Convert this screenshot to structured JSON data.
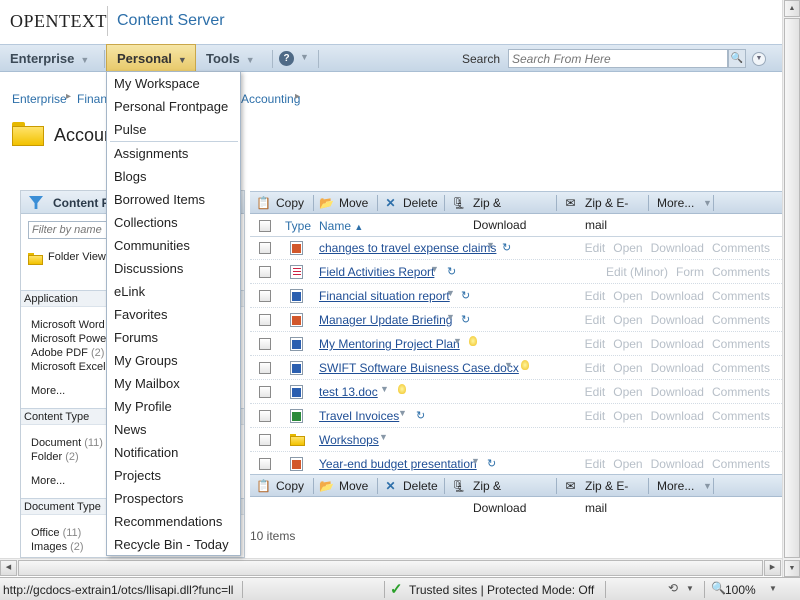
{
  "header": {
    "logo": "OPENTEXT",
    "product": "Content Server"
  },
  "nav": {
    "enterprise": "Enterprise",
    "personal": "Personal",
    "tools": "Tools",
    "search_label": "Search",
    "search_placeholder": "Search From Here"
  },
  "breadcrumb": [
    "Enterprise",
    "Finance",
    "Accounting"
  ],
  "page_title": "Accounting",
  "menu": {
    "items": [
      "My Workspace",
      "Personal Frontpage",
      "Pulse",
      "Assignments",
      "Blogs",
      "Borrowed Items",
      "Collections",
      "Communities",
      "Discussions",
      "eLink",
      "Favorites",
      "Forums",
      "My Groups",
      "My Mailbox",
      "My Profile",
      "News",
      "Notification",
      "Projects",
      "Prospectors",
      "Recommendations",
      "Recycle Bin - Today"
    ]
  },
  "left_panel": {
    "title": "Content Filter",
    "filter_placeholder": "Filter by name",
    "folder_view": "Folder View",
    "application": {
      "header": "Application",
      "items": [
        {
          "label": "Microsoft Word",
          "count": ""
        },
        {
          "label": "Microsoft PowerPoint",
          "count": ""
        },
        {
          "label": "Adobe PDF",
          "count": "(2)"
        },
        {
          "label": "Microsoft Excel",
          "count": ""
        }
      ],
      "more": "More..."
    },
    "content_type": {
      "header": "Content Type",
      "items": [
        {
          "label": "Document",
          "count": "(11)"
        },
        {
          "label": "Folder",
          "count": "(2)"
        }
      ],
      "more": "More..."
    },
    "document_type": {
      "header": "Document Type",
      "items": [
        {
          "label": "Office",
          "count": "(11)"
        },
        {
          "label": "Images",
          "count": "(2)"
        }
      ]
    }
  },
  "toolbar": {
    "copy": "Copy",
    "move": "Move",
    "delete": "Delete",
    "zip_download": "Zip & Download",
    "zip_email": "Zip & E-mail",
    "more": "More..."
  },
  "table": {
    "col_type": "Type",
    "col_name": "Name",
    "rows": [
      {
        "type": "ppt",
        "name": "changes to travel expense claims",
        "actions": [
          "Edit",
          "Open",
          "Download",
          "Comments"
        ]
      },
      {
        "type": "form",
        "name": "Field Activities Report",
        "actions": [
          "Edit (Minor)",
          "Form",
          "Comments"
        ]
      },
      {
        "type": "word",
        "name": "Financial situation report",
        "actions": [
          "Edit",
          "Open",
          "Download",
          "Comments"
        ]
      },
      {
        "type": "ppt",
        "name": "Manager Update Briefing",
        "actions": [
          "Edit",
          "Open",
          "Download",
          "Comments"
        ]
      },
      {
        "type": "word",
        "name": "My Mentoring Project Plan",
        "actions": [
          "Edit",
          "Open",
          "Download",
          "Comments"
        ]
      },
      {
        "type": "word",
        "name": "SWIFT Software Buisness Case.docx",
        "actions": [
          "Edit",
          "Open",
          "Download",
          "Comments"
        ]
      },
      {
        "type": "word",
        "name": "test 13.doc",
        "actions": [
          "Edit",
          "Open",
          "Download",
          "Comments"
        ]
      },
      {
        "type": "xls",
        "name": "Travel Invoices",
        "actions": [
          "Edit",
          "Open",
          "Download",
          "Comments"
        ]
      },
      {
        "type": "folder",
        "name": "Workshops",
        "actions": []
      },
      {
        "type": "ppt",
        "name": "Year-end budget presentation",
        "actions": [
          "Edit",
          "Open",
          "Download",
          "Comments"
        ]
      }
    ],
    "item_count": "10 items"
  },
  "status_bar": {
    "url": "http://gcdocs-extrain1/otcs/llisapi.dll?func=ll",
    "zone": "Trusted sites | Protected Mode: Off",
    "zoom": "100%"
  }
}
